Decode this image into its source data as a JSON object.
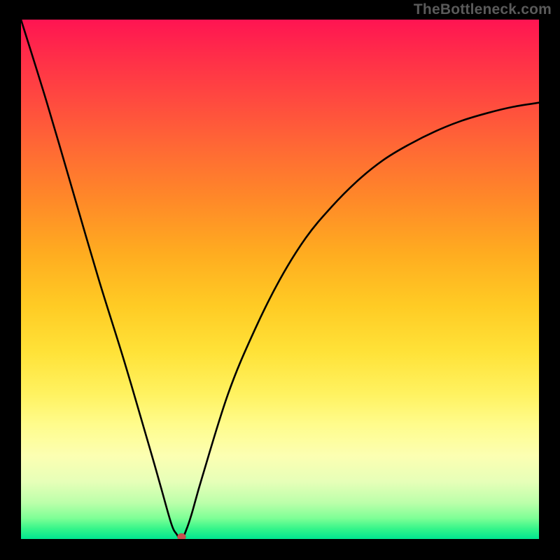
{
  "watermark": "TheBottleneck.com",
  "chart_data": {
    "type": "line",
    "title": "",
    "xlabel": "",
    "ylabel": "",
    "x_range": [
      0,
      100
    ],
    "y_range": [
      0,
      100
    ],
    "grid": false,
    "background_gradient": {
      "top": "#ff1452",
      "bottom": "#00e690",
      "description": "red-to-green vertical gradient (high bottleneck at top, optimal at bottom)"
    },
    "series": [
      {
        "name": "bottleneck-curve",
        "x": [
          0,
          5,
          10,
          15,
          20,
          25,
          27,
          29,
          30,
          31,
          32,
          33,
          35,
          40,
          45,
          50,
          55,
          60,
          65,
          70,
          75,
          80,
          85,
          90,
          95,
          100
        ],
        "y": [
          100,
          84,
          67,
          50,
          34,
          17,
          10,
          3,
          1,
          0,
          2,
          5,
          12,
          28,
          40,
          50,
          58,
          64,
          69,
          73,
          76,
          78.5,
          80.5,
          82,
          83.2,
          84
        ]
      }
    ],
    "marker": {
      "x": 31,
      "y": 0,
      "name": "optimal-point",
      "color": "#c94f4f"
    }
  }
}
